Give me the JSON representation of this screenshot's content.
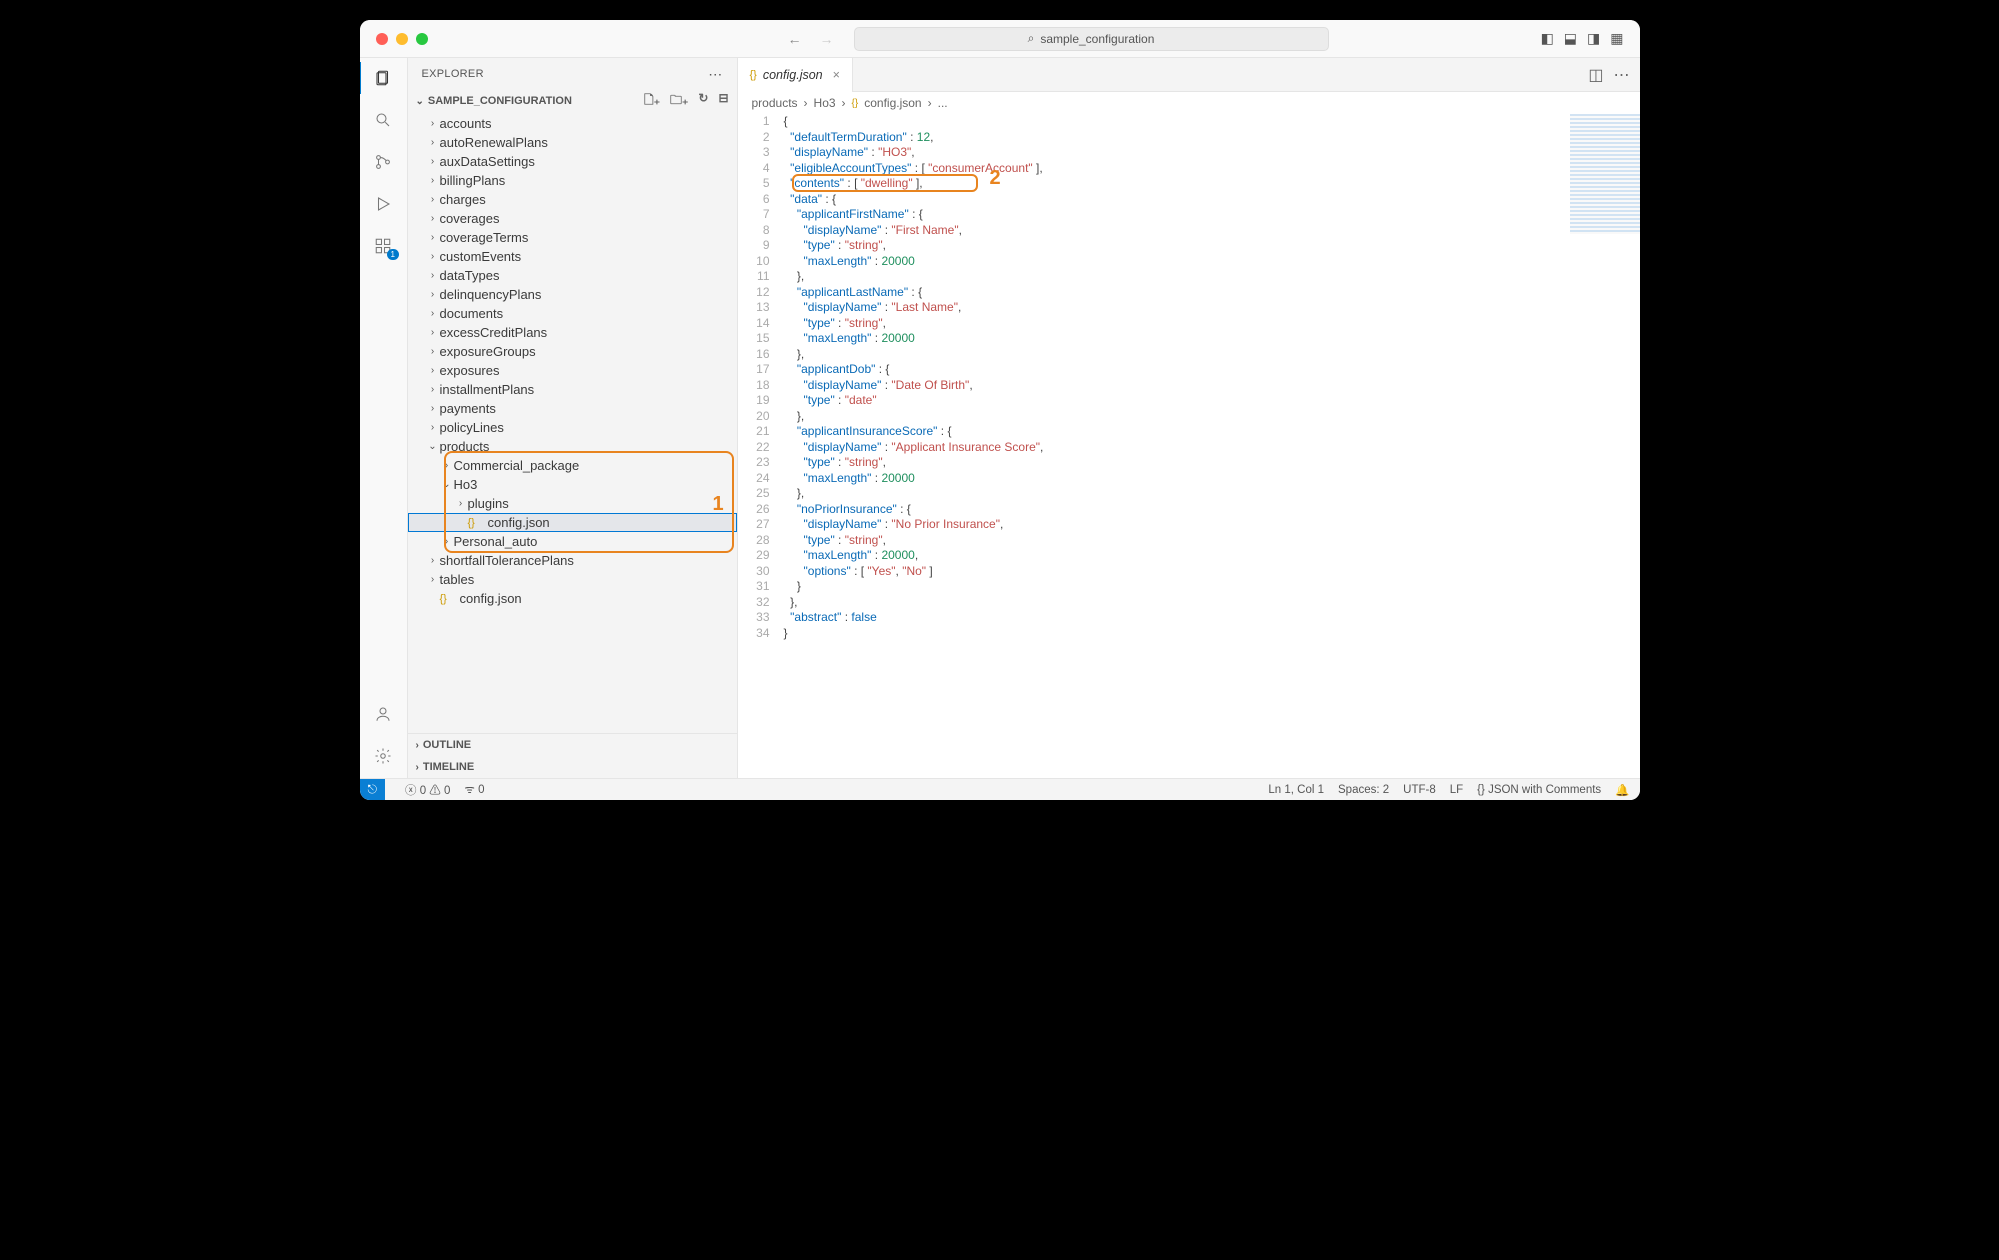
{
  "title_search": "sample_configuration",
  "sidebar": {
    "title": "EXPLORER",
    "folder": "SAMPLE_CONFIGURATION",
    "outline": "OUTLINE",
    "timeline": "TIMELINE",
    "items": [
      {
        "label": "accounts",
        "depth": 1,
        "chev": ">"
      },
      {
        "label": "autoRenewalPlans",
        "depth": 1,
        "chev": ">"
      },
      {
        "label": "auxDataSettings",
        "depth": 1,
        "chev": ">"
      },
      {
        "label": "billingPlans",
        "depth": 1,
        "chev": ">"
      },
      {
        "label": "charges",
        "depth": 1,
        "chev": ">"
      },
      {
        "label": "coverages",
        "depth": 1,
        "chev": ">"
      },
      {
        "label": "coverageTerms",
        "depth": 1,
        "chev": ">"
      },
      {
        "label": "customEvents",
        "depth": 1,
        "chev": ">"
      },
      {
        "label": "dataTypes",
        "depth": 1,
        "chev": ">"
      },
      {
        "label": "delinquencyPlans",
        "depth": 1,
        "chev": ">"
      },
      {
        "label": "documents",
        "depth": 1,
        "chev": ">"
      },
      {
        "label": "excessCreditPlans",
        "depth": 1,
        "chev": ">"
      },
      {
        "label": "exposureGroups",
        "depth": 1,
        "chev": ">"
      },
      {
        "label": "exposures",
        "depth": 1,
        "chev": ">"
      },
      {
        "label": "installmentPlans",
        "depth": 1,
        "chev": ">"
      },
      {
        "label": "payments",
        "depth": 1,
        "chev": ">"
      },
      {
        "label": "policyLines",
        "depth": 1,
        "chev": ">"
      },
      {
        "label": "products",
        "depth": 1,
        "chev": "v"
      },
      {
        "label": "Commercial_package",
        "depth": 2,
        "chev": ">"
      },
      {
        "label": "Ho3",
        "depth": 2,
        "chev": "v"
      },
      {
        "label": "plugins",
        "depth": 3,
        "chev": ">"
      },
      {
        "label": "config.json",
        "depth": 3,
        "file": true,
        "selected": true
      },
      {
        "label": "Personal_auto",
        "depth": 2,
        "chev": ">"
      },
      {
        "label": "shortfallTolerancePlans",
        "depth": 1,
        "chev": ">"
      },
      {
        "label": "tables",
        "depth": 1,
        "chev": ">"
      },
      {
        "label": "config.json",
        "depth": 1,
        "file": true
      }
    ]
  },
  "tab": {
    "file": "config.json"
  },
  "breadcrumb": [
    "products",
    "Ho3",
    "config.json",
    "..."
  ],
  "annotations": {
    "tree": "1",
    "code": "2"
  },
  "status": {
    "errors": "0",
    "warnings": "0",
    "ports": "0",
    "pos": "Ln 1, Col 1",
    "spaces": "Spaces: 2",
    "enc": "UTF-8",
    "eol": "LF",
    "lang": "JSON with Comments"
  },
  "code_lines": [
    [
      {
        "t": "{",
        "c": "p"
      }
    ],
    [
      {
        "t": "  ",
        "c": "p"
      },
      {
        "t": "\"defaultTermDuration\"",
        "c": "k"
      },
      {
        "t": " : ",
        "c": "p"
      },
      {
        "t": "12",
        "c": "n"
      },
      {
        "t": ",",
        "c": "p"
      }
    ],
    [
      {
        "t": "  ",
        "c": "p"
      },
      {
        "t": "\"displayName\"",
        "c": "k"
      },
      {
        "t": " : ",
        "c": "p"
      },
      {
        "t": "\"HO3\"",
        "c": "s"
      },
      {
        "t": ",",
        "c": "p"
      }
    ],
    [
      {
        "t": "  ",
        "c": "p"
      },
      {
        "t": "\"eligibleAccountTypes\"",
        "c": "k"
      },
      {
        "t": " : [ ",
        "c": "p"
      },
      {
        "t": "\"consumerAccount\"",
        "c": "s"
      },
      {
        "t": " ],",
        "c": "p"
      }
    ],
    [
      {
        "t": "  ",
        "c": "p"
      },
      {
        "t": "\"contents\"",
        "c": "k"
      },
      {
        "t": " : [ ",
        "c": "p"
      },
      {
        "t": "\"dwelling\"",
        "c": "s"
      },
      {
        "t": " ],",
        "c": "p"
      }
    ],
    [
      {
        "t": "  ",
        "c": "p"
      },
      {
        "t": "\"data\"",
        "c": "k"
      },
      {
        "t": " : {",
        "c": "p"
      }
    ],
    [
      {
        "t": "    ",
        "c": "p"
      },
      {
        "t": "\"applicantFirstName\"",
        "c": "k"
      },
      {
        "t": " : {",
        "c": "p"
      }
    ],
    [
      {
        "t": "      ",
        "c": "p"
      },
      {
        "t": "\"displayName\"",
        "c": "k"
      },
      {
        "t": " : ",
        "c": "p"
      },
      {
        "t": "\"First Name\"",
        "c": "s"
      },
      {
        "t": ",",
        "c": "p"
      }
    ],
    [
      {
        "t": "      ",
        "c": "p"
      },
      {
        "t": "\"type\"",
        "c": "k"
      },
      {
        "t": " : ",
        "c": "p"
      },
      {
        "t": "\"string\"",
        "c": "s"
      },
      {
        "t": ",",
        "c": "p"
      }
    ],
    [
      {
        "t": "      ",
        "c": "p"
      },
      {
        "t": "\"maxLength\"",
        "c": "k"
      },
      {
        "t": " : ",
        "c": "p"
      },
      {
        "t": "20000",
        "c": "n"
      }
    ],
    [
      {
        "t": "    },",
        "c": "p"
      }
    ],
    [
      {
        "t": "    ",
        "c": "p"
      },
      {
        "t": "\"applicantLastName\"",
        "c": "k"
      },
      {
        "t": " : {",
        "c": "p"
      }
    ],
    [
      {
        "t": "      ",
        "c": "p"
      },
      {
        "t": "\"displayName\"",
        "c": "k"
      },
      {
        "t": " : ",
        "c": "p"
      },
      {
        "t": "\"Last Name\"",
        "c": "s"
      },
      {
        "t": ",",
        "c": "p"
      }
    ],
    [
      {
        "t": "      ",
        "c": "p"
      },
      {
        "t": "\"type\"",
        "c": "k"
      },
      {
        "t": " : ",
        "c": "p"
      },
      {
        "t": "\"string\"",
        "c": "s"
      },
      {
        "t": ",",
        "c": "p"
      }
    ],
    [
      {
        "t": "      ",
        "c": "p"
      },
      {
        "t": "\"maxLength\"",
        "c": "k"
      },
      {
        "t": " : ",
        "c": "p"
      },
      {
        "t": "20000",
        "c": "n"
      }
    ],
    [
      {
        "t": "    },",
        "c": "p"
      }
    ],
    [
      {
        "t": "    ",
        "c": "p"
      },
      {
        "t": "\"applicantDob\"",
        "c": "k"
      },
      {
        "t": " : {",
        "c": "p"
      }
    ],
    [
      {
        "t": "      ",
        "c": "p"
      },
      {
        "t": "\"displayName\"",
        "c": "k"
      },
      {
        "t": " : ",
        "c": "p"
      },
      {
        "t": "\"Date Of Birth\"",
        "c": "s"
      },
      {
        "t": ",",
        "c": "p"
      }
    ],
    [
      {
        "t": "      ",
        "c": "p"
      },
      {
        "t": "\"type\"",
        "c": "k"
      },
      {
        "t": " : ",
        "c": "p"
      },
      {
        "t": "\"date\"",
        "c": "s"
      }
    ],
    [
      {
        "t": "    },",
        "c": "p"
      }
    ],
    [
      {
        "t": "    ",
        "c": "p"
      },
      {
        "t": "\"applicantInsuranceScore\"",
        "c": "k"
      },
      {
        "t": " : {",
        "c": "p"
      }
    ],
    [
      {
        "t": "      ",
        "c": "p"
      },
      {
        "t": "\"displayName\"",
        "c": "k"
      },
      {
        "t": " : ",
        "c": "p"
      },
      {
        "t": "\"Applicant Insurance Score\"",
        "c": "s"
      },
      {
        "t": ",",
        "c": "p"
      }
    ],
    [
      {
        "t": "      ",
        "c": "p"
      },
      {
        "t": "\"type\"",
        "c": "k"
      },
      {
        "t": " : ",
        "c": "p"
      },
      {
        "t": "\"string\"",
        "c": "s"
      },
      {
        "t": ",",
        "c": "p"
      }
    ],
    [
      {
        "t": "      ",
        "c": "p"
      },
      {
        "t": "\"maxLength\"",
        "c": "k"
      },
      {
        "t": " : ",
        "c": "p"
      },
      {
        "t": "20000",
        "c": "n"
      }
    ],
    [
      {
        "t": "    },",
        "c": "p"
      }
    ],
    [
      {
        "t": "    ",
        "c": "p"
      },
      {
        "t": "\"noPriorInsurance\"",
        "c": "k"
      },
      {
        "t": " : {",
        "c": "p"
      }
    ],
    [
      {
        "t": "      ",
        "c": "p"
      },
      {
        "t": "\"displayName\"",
        "c": "k"
      },
      {
        "t": " : ",
        "c": "p"
      },
      {
        "t": "\"No Prior Insurance\"",
        "c": "s"
      },
      {
        "t": ",",
        "c": "p"
      }
    ],
    [
      {
        "t": "      ",
        "c": "p"
      },
      {
        "t": "\"type\"",
        "c": "k"
      },
      {
        "t": " : ",
        "c": "p"
      },
      {
        "t": "\"string\"",
        "c": "s"
      },
      {
        "t": ",",
        "c": "p"
      }
    ],
    [
      {
        "t": "      ",
        "c": "p"
      },
      {
        "t": "\"maxLength\"",
        "c": "k"
      },
      {
        "t": " : ",
        "c": "p"
      },
      {
        "t": "20000",
        "c": "n"
      },
      {
        "t": ",",
        "c": "p"
      }
    ],
    [
      {
        "t": "      ",
        "c": "p"
      },
      {
        "t": "\"options\"",
        "c": "k"
      },
      {
        "t": " : [ ",
        "c": "p"
      },
      {
        "t": "\"Yes\"",
        "c": "s"
      },
      {
        "t": ", ",
        "c": "p"
      },
      {
        "t": "\"No\"",
        "c": "s"
      },
      {
        "t": " ]",
        "c": "p"
      }
    ],
    [
      {
        "t": "    }",
        "c": "p"
      }
    ],
    [
      {
        "t": "  },",
        "c": "p"
      }
    ],
    [
      {
        "t": "  ",
        "c": "p"
      },
      {
        "t": "\"abstract\"",
        "c": "k"
      },
      {
        "t": " : ",
        "c": "p"
      },
      {
        "t": "false",
        "c": "b"
      }
    ],
    [
      {
        "t": "}",
        "c": "p"
      }
    ]
  ]
}
